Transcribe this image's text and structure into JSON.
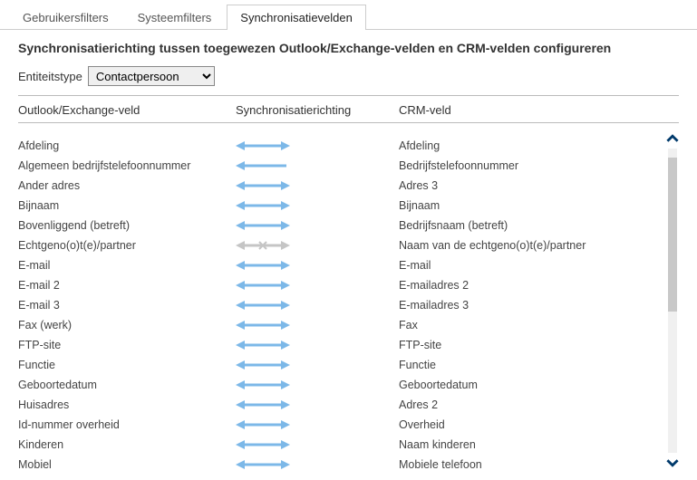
{
  "tabs": [
    {
      "label": "Gebruikersfilters",
      "active": false
    },
    {
      "label": "Systeemfilters",
      "active": false
    },
    {
      "label": "Synchronisatievelden",
      "active": true
    }
  ],
  "title": "Synchronisatierichting tussen toegewezen Outlook/Exchange-velden en CRM-velden configureren",
  "entity_label": "Entiteitstype",
  "entity_select": {
    "value": "Contactpersoon"
  },
  "columns": {
    "left": "Outlook/Exchange-veld",
    "mid": "Synchronisatierichting",
    "right": "CRM-veld"
  },
  "rows": [
    {
      "left": "Afdeling",
      "dir": "both",
      "right": "Afdeling"
    },
    {
      "left": "Algemeen bedrijfstelefoonnummer",
      "dir": "left",
      "right": "Bedrijfstelefoonnummer"
    },
    {
      "left": "Ander adres",
      "dir": "both",
      "right": "Adres 3"
    },
    {
      "left": "Bijnaam",
      "dir": "both",
      "right": "Bijnaam"
    },
    {
      "left": "Bovenliggend (betreft)",
      "dir": "both",
      "right": "Bedrijfsnaam (betreft)"
    },
    {
      "left": "Echtgeno(o)t(e)/partner",
      "dir": "none",
      "right": "Naam van de echtgeno(o)t(e)/partner"
    },
    {
      "left": "E-mail",
      "dir": "both",
      "right": "E-mail"
    },
    {
      "left": "E-mail 2",
      "dir": "both",
      "right": "E-mailadres 2"
    },
    {
      "left": "E-mail 3",
      "dir": "both",
      "right": "E-mailadres 3"
    },
    {
      "left": "Fax (werk)",
      "dir": "both",
      "right": "Fax"
    },
    {
      "left": "FTP-site",
      "dir": "both",
      "right": "FTP-site"
    },
    {
      "left": "Functie",
      "dir": "both",
      "right": "Functie"
    },
    {
      "left": "Geboortedatum",
      "dir": "both",
      "right": "Geboortedatum"
    },
    {
      "left": "Huisadres",
      "dir": "both",
      "right": "Adres 2"
    },
    {
      "left": "Id-nummer overheid",
      "dir": "both",
      "right": "Overheid"
    },
    {
      "left": "Kinderen",
      "dir": "both",
      "right": "Naam kinderen"
    },
    {
      "left": "Mobiel",
      "dir": "both",
      "right": "Mobiele telefoon"
    }
  ]
}
